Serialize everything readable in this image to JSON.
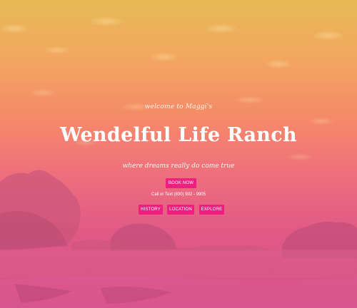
{
  "hero": {
    "welcome_text": "welcome to Maggi's",
    "title": "Wendelful Life Ranch",
    "tagline": "where dreams really do come true",
    "contact_text": "Call or Text (830) 992 - 9905"
  },
  "buttons": {
    "book_now": "BOOK NOW",
    "history": "HISTORY",
    "location": "LOCATION",
    "explore": "EXPLORE"
  },
  "colors": {
    "button_accent": "#ee1f7f",
    "sky_top": "#e7b955",
    "sky_bottom": "#d44d85"
  }
}
